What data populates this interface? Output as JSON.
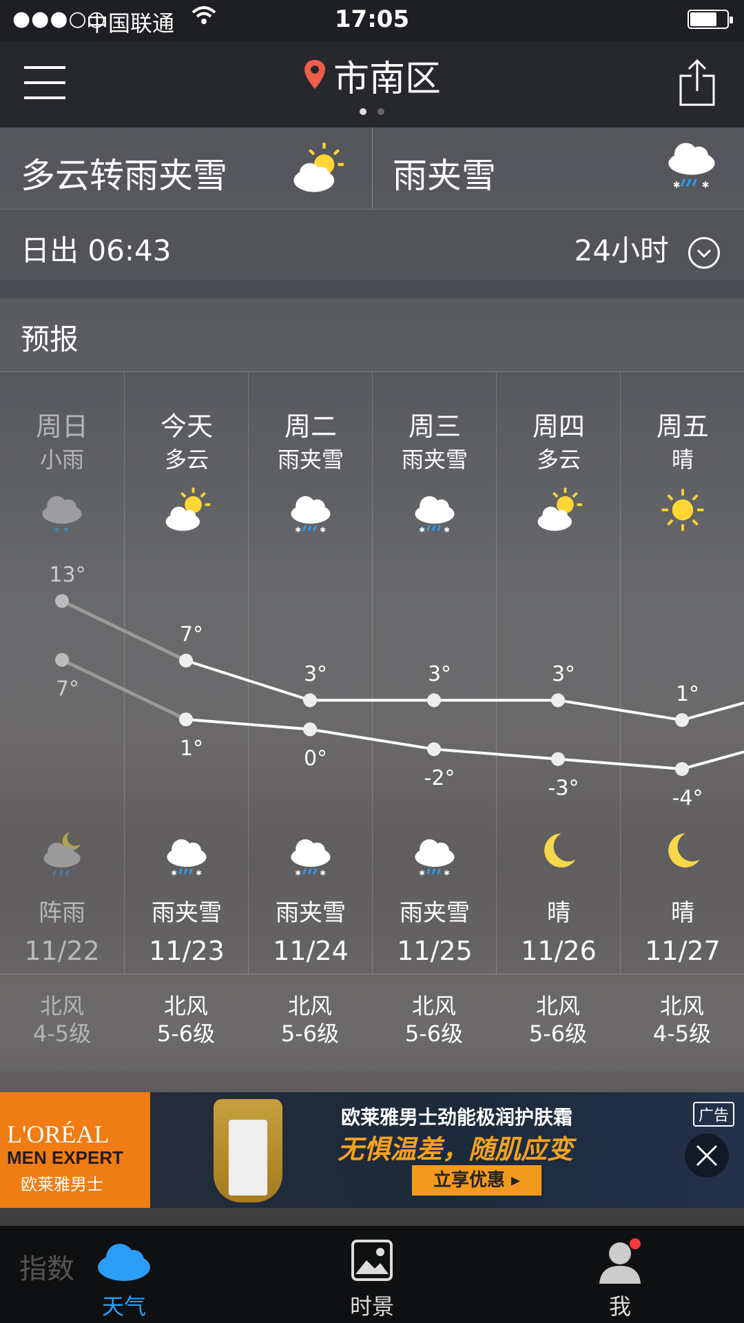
{
  "status_bar": {
    "signal": "●●●○○",
    "carrier": "中国联通",
    "time": "17:05"
  },
  "header": {
    "city": "市南区"
  },
  "summary": {
    "today": "多云转雨夹雪",
    "tomorrow": "雨夹雪"
  },
  "sunrise": {
    "label": "日出",
    "time": "06:43",
    "toggle_label": "24小时"
  },
  "forecast": {
    "title": "预报",
    "days": [
      {
        "day": "周日",
        "cond": "小雨",
        "high": "13°",
        "low": "7°",
        "night_cond": "阵雨",
        "date": "11/22",
        "wind_dir": "北风",
        "wind_level": "4-5级",
        "icon_day": "cloud-rain-icon",
        "icon_night": "cloud-moon-rain-icon"
      },
      {
        "day": "今天",
        "cond": "多云",
        "high": "7°",
        "low": "1°",
        "night_cond": "雨夹雪",
        "date": "11/23",
        "wind_dir": "北风",
        "wind_level": "5-6级",
        "icon_day": "partly-cloudy-sun-icon",
        "icon_night": "sleet-icon"
      },
      {
        "day": "周二",
        "cond": "雨夹雪",
        "high": "3°",
        "low": "0°",
        "night_cond": "雨夹雪",
        "date": "11/24",
        "wind_dir": "北风",
        "wind_level": "5-6级",
        "icon_day": "sleet-icon",
        "icon_night": "sleet-icon"
      },
      {
        "day": "周三",
        "cond": "雨夹雪",
        "high": "3°",
        "low": "-2°",
        "night_cond": "雨夹雪",
        "date": "11/25",
        "wind_dir": "北风",
        "wind_level": "5-6级",
        "icon_day": "sleet-icon",
        "icon_night": "sleet-icon"
      },
      {
        "day": "周四",
        "cond": "多云",
        "high": "3°",
        "low": "-3°",
        "night_cond": "晴",
        "date": "11/26",
        "wind_dir": "北风",
        "wind_level": "5-6级",
        "icon_day": "partly-cloudy-sun-icon",
        "icon_night": "moon-icon"
      },
      {
        "day": "周五",
        "cond": "晴",
        "high": "1°",
        "low": "-4°",
        "night_cond": "晴",
        "date": "11/27",
        "wind_dir": "北风",
        "wind_level": "4-5级",
        "icon_day": "sun-icon",
        "icon_night": "moon-icon"
      }
    ]
  },
  "ad": {
    "brand_line1": "L'ORÉAL",
    "brand_line2": "MEN EXPERT",
    "brand_line3": "欧莱雅男士",
    "headline1": "欧莱雅男士劲能极润护肤霜",
    "headline2": "无惧温差，随肌应变",
    "cta": "立享优惠 ▸",
    "tag": "广告"
  },
  "tabbar": {
    "index_label": "指数",
    "tabs": [
      {
        "label": "天气",
        "active": true
      },
      {
        "label": "时景",
        "active": false
      },
      {
        "label": "我",
        "active": false
      }
    ]
  },
  "colors": {
    "accent": "#2a9df4",
    "sun": "#ffd633",
    "moon": "#f5d84a",
    "notification": "#f23a3a",
    "ad_orange": "#f07c14"
  }
}
